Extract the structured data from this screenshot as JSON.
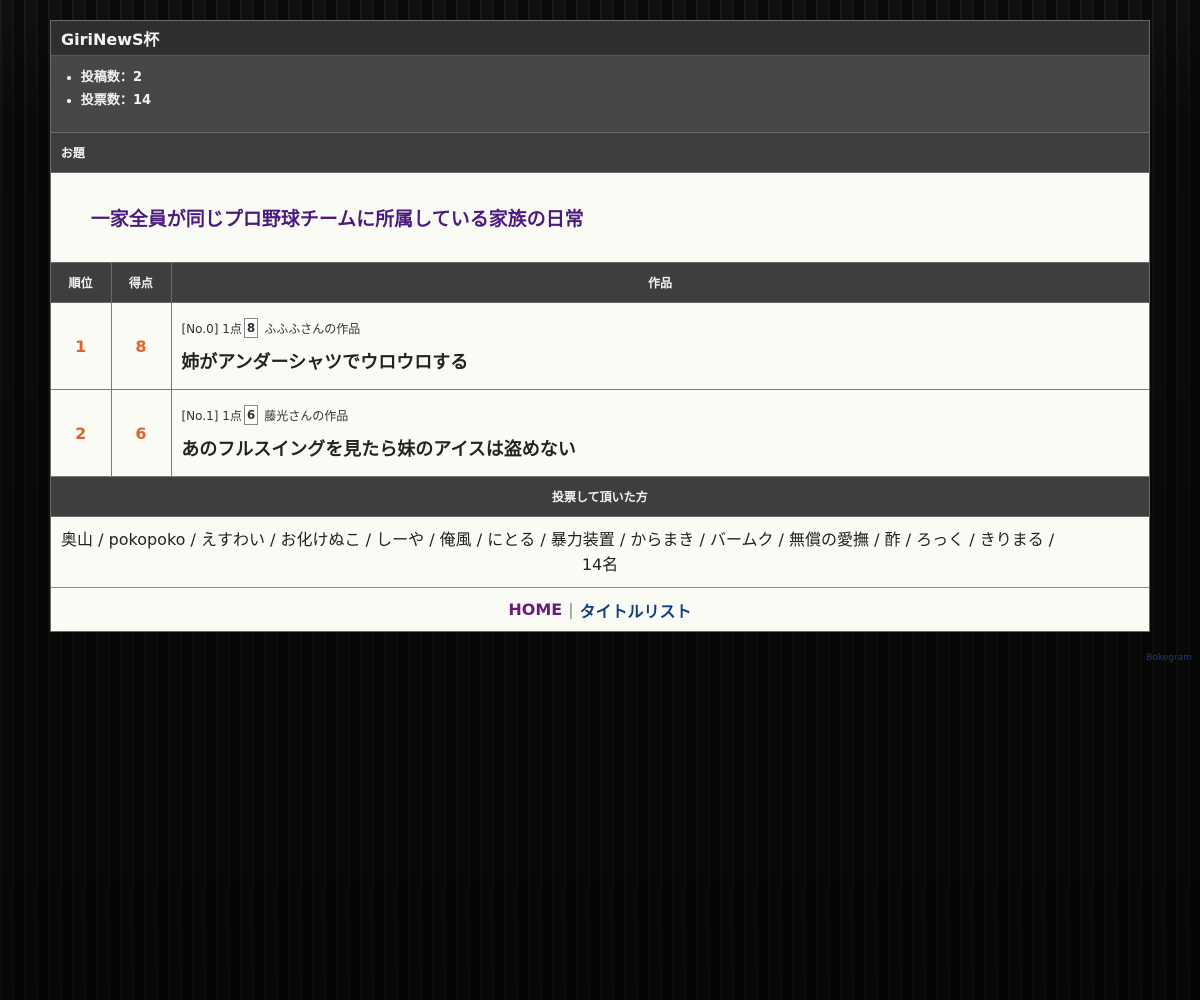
{
  "contest": {
    "title": "GiriNewS杯",
    "stats": [
      {
        "label": "投稿数：2"
      },
      {
        "label": "投票数：14"
      }
    ]
  },
  "theme": {
    "header": "お題",
    "text": "一家全員が同じプロ野球チームに所属している家族の日常"
  },
  "results": {
    "headers": {
      "rank": "順位",
      "score": "得点",
      "work": "作品"
    },
    "rows": [
      {
        "rank": "1",
        "score": "8",
        "meta_prefix": "[No.0] 1点",
        "points": "8",
        "author": "ふふふさんの作品",
        "title": "姉がアンダーシャツでウロウロする"
      },
      {
        "rank": "2",
        "score": "6",
        "meta_prefix": "[No.1] 1点",
        "points": "6",
        "author": "藤光さんの作品",
        "title": "あのフルスイングを見たら妹のアイスは盗めない"
      }
    ]
  },
  "voters": {
    "header": "投票して頂いた方",
    "list": "奥山 / pokopoko / えすわい / お化けぬこ / しーや / 俺風 / にとる / 暴力装置 / からまき / バームク / 無償の愛撫 / 酢 / ろっく / きりまる /",
    "count": "14名"
  },
  "nav": {
    "home": "HOME",
    "separator": "|",
    "title_list": "タイトルリスト"
  },
  "credit": "Bokegram",
  "colors": {
    "rank_number": "#e0622a",
    "theme_text": "#4b1a7f",
    "home_link": "#6a1a7a",
    "title_list_link": "#0d3e86",
    "header_bg": "#3e3e3e"
  }
}
